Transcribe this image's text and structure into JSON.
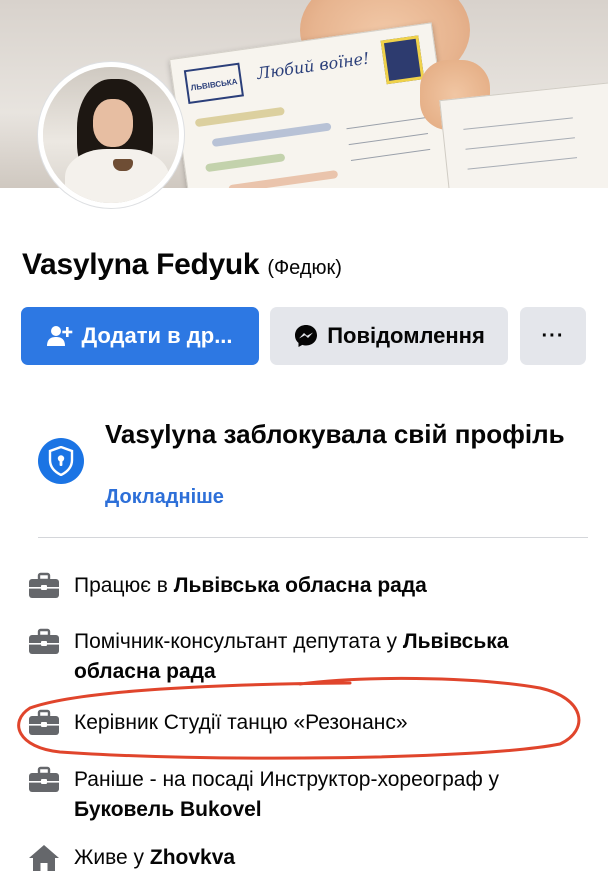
{
  "profile": {
    "name": "Vasylyna Fedyuk",
    "alternate_name": "(Федюк)"
  },
  "actions": {
    "add_friend_label": "Додати в др...",
    "message_label": "Повідомлення",
    "more_label": "···"
  },
  "locked": {
    "title": "Vasylyna заблокувала свій профіль",
    "learn_more": "Докладніше"
  },
  "cover_text": {
    "postcard_heading": "Любий воїне!",
    "logo_text": "ЛЬВІВСЬКА"
  },
  "details": [
    {
      "icon": "briefcase-icon",
      "prefix": "Працює в ",
      "bold": "Львівська обласна рада",
      "suffix": ""
    },
    {
      "icon": "briefcase-icon",
      "prefix": "Помічник-консультант депутата у ",
      "bold": "Львівська обласна рада",
      "suffix": ""
    },
    {
      "icon": "briefcase-icon",
      "prefix": "Керівник Студії танцю «Резонанс»",
      "bold": "",
      "suffix": ""
    },
    {
      "icon": "briefcase-icon",
      "prefix": "Раніше - на посаді Инструктор-хореограф у ",
      "bold": "Буковель Bukovel",
      "suffix": ""
    },
    {
      "icon": "home-icon",
      "prefix": "Живе у ",
      "bold": "Zhovkva",
      "suffix": ""
    }
  ],
  "colors": {
    "primary_button": "#2d78e3",
    "secondary_button": "#e4e6eb",
    "link": "#2d6fd8",
    "annotation": "#e0452c"
  }
}
